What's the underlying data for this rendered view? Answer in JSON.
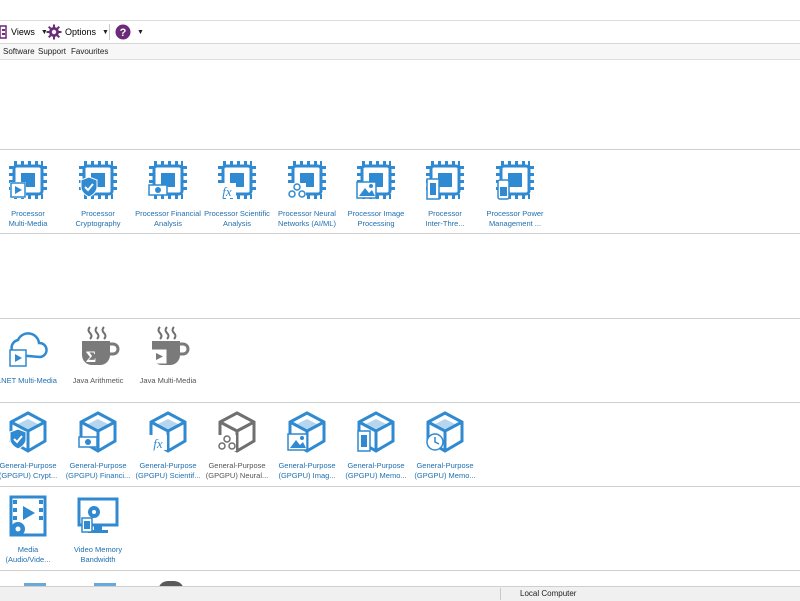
{
  "toolbar": {
    "views_label": "Views",
    "options_label": "Options",
    "help_icon": "help-icon",
    "accent": "#6b2a7a"
  },
  "menu": [
    "Software",
    "Support",
    "Favourites"
  ],
  "sections": {
    "processor": [
      {
        "icon": "cpu-multimedia-icon",
        "line1": "Processor",
        "line2": "Multi-Media"
      },
      {
        "icon": "cpu-shield-icon",
        "line1": "Processor",
        "line2": "Cryptography"
      },
      {
        "icon": "cpu-money-icon",
        "line1": "Processor Financial",
        "line2": "Analysis"
      },
      {
        "icon": "cpu-fx-icon",
        "line1": "Processor Scientific",
        "line2": "Analysis"
      },
      {
        "icon": "cpu-neural-icon",
        "line1": "Processor Neural",
        "line2": "Networks (AI/ML)"
      },
      {
        "icon": "cpu-image-icon",
        "line1": "Processor Image",
        "line2": "Processing"
      },
      {
        "icon": "cpu-thread-icon",
        "line1": "Processor",
        "line2": "Inter-Thre..."
      },
      {
        "icon": "cpu-power-icon",
        "line1": "Processor Power",
        "line2": "Management ..."
      }
    ],
    "runtime": [
      {
        "icon": "cloud-media-icon",
        "line1": ".NET Multi-Media",
        "line2": ""
      },
      {
        "icon": "java-sigma-icon",
        "line1": "Java Arithmetic",
        "line2": ""
      },
      {
        "icon": "java-media-icon",
        "line1": "Java Multi-Media",
        "line2": ""
      }
    ],
    "gpgpu": [
      {
        "icon": "gpu-shield-icon",
        "line1": "General-Purpose",
        "line2": "(GPGPU) Crypt..."
      },
      {
        "icon": "gpu-money-icon",
        "line1": "General-Purpose",
        "line2": "(GPGPU) Financi..."
      },
      {
        "icon": "gpu-fx-icon",
        "line1": "General-Purpose",
        "line2": "(GPGPU) Scientif..."
      },
      {
        "icon": "gpu-neural-icon",
        "line1": "General-Purpose",
        "line2": "(GPGPU) Neural..."
      },
      {
        "icon": "gpu-image-icon",
        "line1": "General-Purpose",
        "line2": "(GPGPU) Imag..."
      },
      {
        "icon": "gpu-memory-icon",
        "line1": "General-Purpose",
        "line2": "(GPGPU) Memo..."
      },
      {
        "icon": "gpu-clock-icon",
        "line1": "General-Purpose",
        "line2": "(GPGPU) Memo..."
      }
    ],
    "media": [
      {
        "icon": "media-transcode-icon",
        "line1": "Media",
        "line2": "(Audio/Vide..."
      },
      {
        "icon": "video-memory-icon",
        "line1": "Video Memory",
        "line2": "Bandwidth"
      }
    ]
  },
  "status": {
    "text": "Local Computer"
  }
}
